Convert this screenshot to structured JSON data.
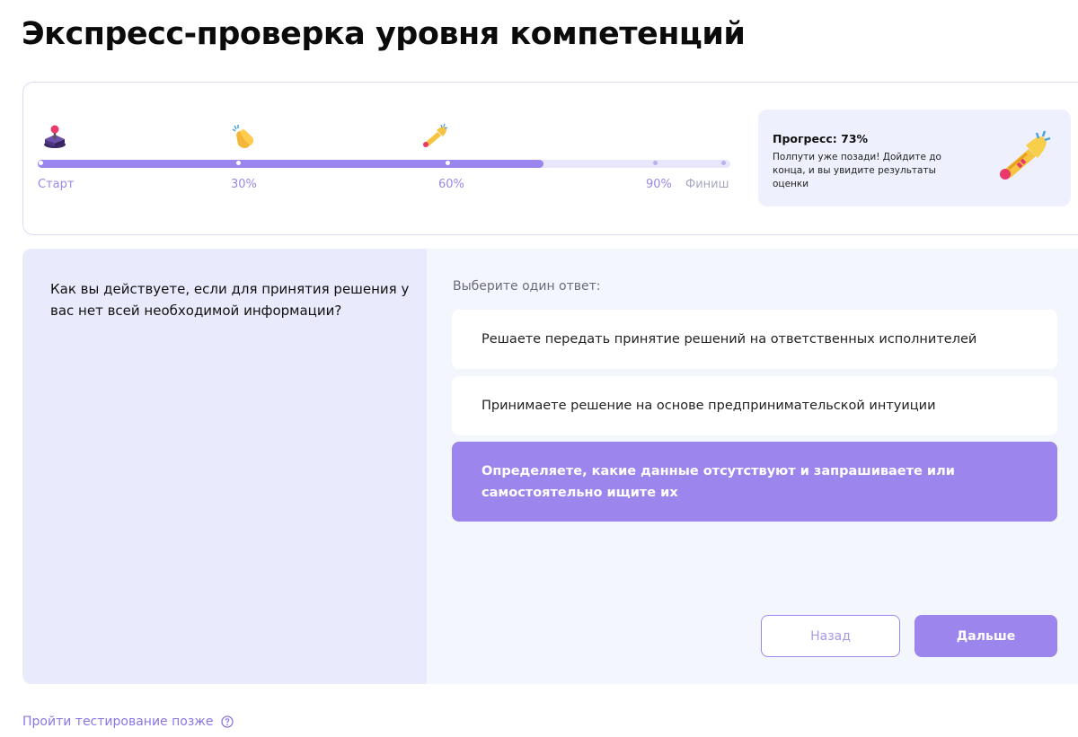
{
  "page": {
    "title": "Экспресс-проверка уровня компетенций"
  },
  "progress": {
    "percent": 73,
    "milestones": [
      {
        "label": "Старт",
        "icon": "joystick-icon"
      },
      {
        "label": "30%",
        "icon": "clapping-hands-icon"
      },
      {
        "label": "60%",
        "icon": "trumpet-icon"
      },
      {
        "label": "90%",
        "icon": ""
      },
      {
        "label": "Финиш",
        "icon": ""
      }
    ],
    "info_title": "Прогресс: 73%",
    "info_text": "Полпути уже позади! Дойдите до конца, и вы увидите результаты оценки",
    "info_icon": "trumpet-icon"
  },
  "question": {
    "text": "Как вы действуете, если для принятия решения у вас нет всей необходимой информации?"
  },
  "answers": {
    "hint": "Выберите один ответ:",
    "options": [
      {
        "label": "Решаете передать принятие решений на ответственных исполнителей",
        "selected": false
      },
      {
        "label": "Принимаете решение на основе предпринимательской интуиции",
        "selected": false
      },
      {
        "label": "Определяете, какие данные отсутствуют и запрашиваете или самостоятельно ищите их",
        "selected": true
      }
    ]
  },
  "buttons": {
    "back": "Назад",
    "next": "Дальше"
  },
  "footer": {
    "later_link": "Пройти тестирование позже",
    "help_icon": "question-circle-icon"
  },
  "colors": {
    "accent": "#9c86ee",
    "track": "#e8e6fb",
    "panel_bg": "#e9ebfc"
  }
}
